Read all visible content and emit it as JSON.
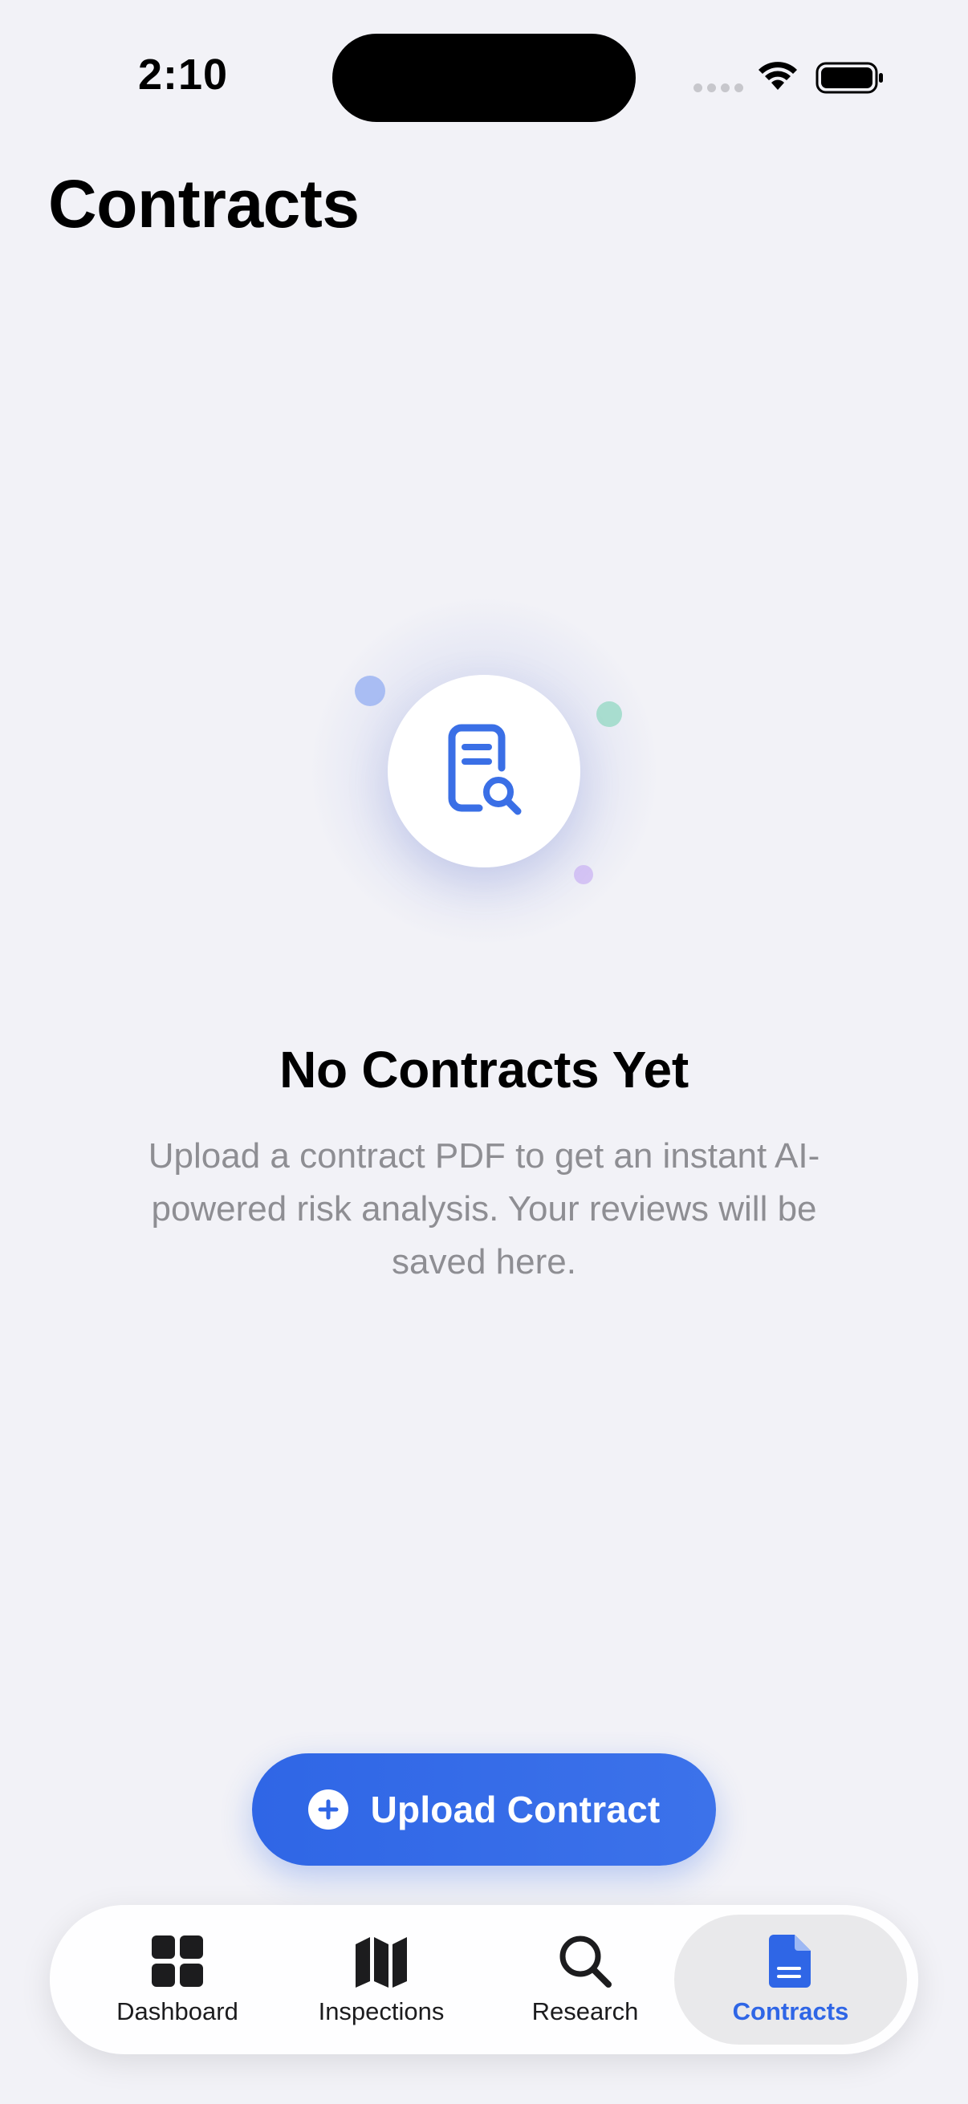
{
  "status_bar": {
    "time": "2:10"
  },
  "header": {
    "title": "Contracts"
  },
  "empty_state": {
    "icon": "document-search-icon",
    "title": "No Contracts Yet",
    "message": "Upload a contract PDF to get an instant AI-powered risk analysis. Your reviews will be saved here."
  },
  "upload_button": {
    "icon": "plus-circle-icon",
    "label": "Upload Contract"
  },
  "tab_bar": {
    "tabs": [
      {
        "label": "Dashboard",
        "icon": "grid-icon"
      },
      {
        "label": "Inspections",
        "icon": "map-icon"
      },
      {
        "label": "Research",
        "icon": "search-icon"
      },
      {
        "label": "Contracts",
        "icon": "document-icon",
        "selected": true
      }
    ]
  },
  "colors": {
    "accent": "#2F66E6",
    "background": "#F2F2F7",
    "secondary_text": "#8E8E93"
  }
}
